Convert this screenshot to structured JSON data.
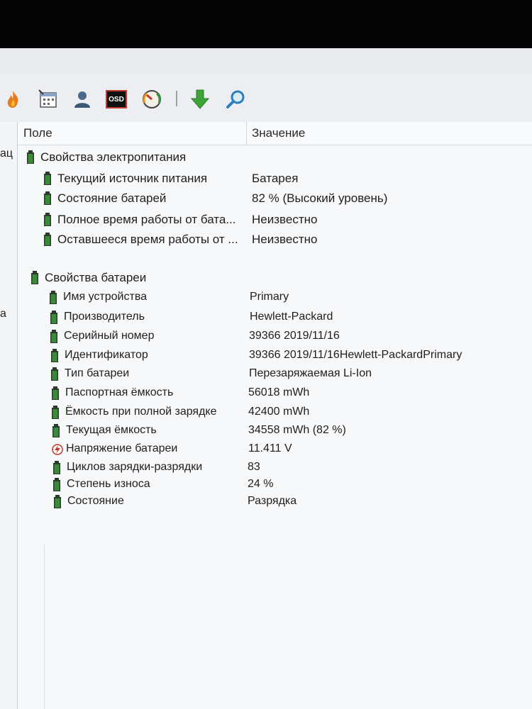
{
  "toolbar": {
    "buttons": [
      {
        "name": "flame-icon",
        "glyph": "🔥"
      },
      {
        "name": "calendar-icon",
        "glyph": "📅"
      },
      {
        "name": "user-icon",
        "glyph": "👤"
      },
      {
        "name": "osd-icon",
        "label": "OSD"
      },
      {
        "name": "gauge-icon",
        "glyph": "◔"
      },
      {
        "name": "download-arrow-icon",
        "glyph": "⬇"
      },
      {
        "name": "search-icon",
        "glyph": "🔍"
      }
    ]
  },
  "left_pane": {
    "fragments": [
      "ац",
      "а"
    ]
  },
  "grid": {
    "headers": {
      "field": "Поле",
      "value": "Значение"
    },
    "sections": [
      {
        "title": "Свойства электропитания",
        "rows": [
          {
            "name": "Текущий источник питания",
            "value": "Батарея"
          },
          {
            "name": "Состояние батарей",
            "value": "82 % (Высокий уровень)"
          },
          {
            "name": "Полное время работы от бата...",
            "value": "Неизвестно"
          },
          {
            "name": "Оставшееся время работы от ...",
            "value": "Неизвестно"
          }
        ]
      },
      {
        "title": "Свойства батареи",
        "rows": [
          {
            "name": "Имя устройства",
            "value": "Primary"
          },
          {
            "name": "Производитель",
            "value": "Hewlett-Packard"
          },
          {
            "name": "Серийный номер",
            "value": "39366 2019/11/16"
          },
          {
            "name": "Идентификатор",
            "value": "39366 2019/11/16Hewlett-PackardPrimary"
          },
          {
            "name": "Тип батареи",
            "value": "Перезаряжаемая Li-Ion"
          },
          {
            "name": "Паспортная ёмкость",
            "value": "56018 mWh"
          },
          {
            "name": "Ёмкость при полной зарядке",
            "value": "42400 mWh"
          },
          {
            "name": "Текущая ёмкость",
            "value": "34558 mWh  (82 %)"
          },
          {
            "name": "Напряжение батареи",
            "value": "11.411 V",
            "icon": "voltage"
          },
          {
            "name": "Циклов зарядки-разрядки",
            "value": "83"
          },
          {
            "name": "Степень износа",
            "value": "24 %"
          },
          {
            "name": "Состояние",
            "value": "Разрядка"
          }
        ]
      }
    ]
  },
  "colors": {
    "battery_green": "#3a8a3a",
    "battery_dark": "#2c3a2c",
    "voltage_red": "#c0392b"
  }
}
